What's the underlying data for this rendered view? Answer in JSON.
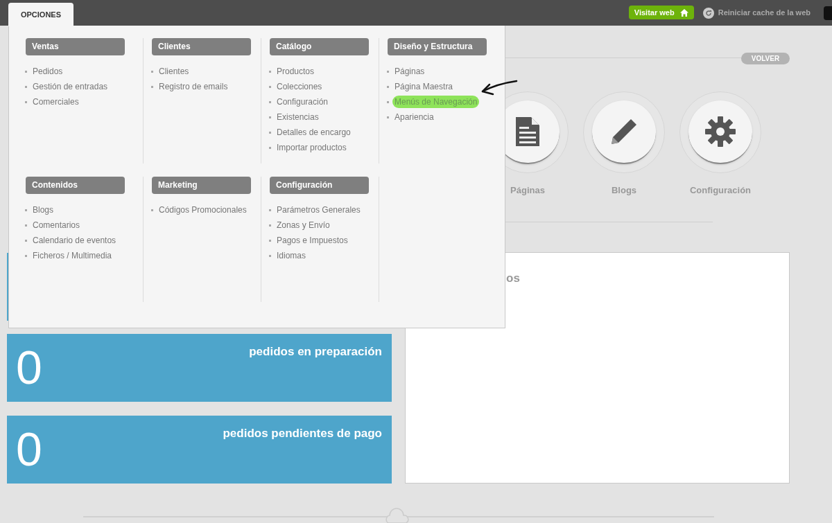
{
  "top_bar": {
    "menu_tab": {
      "label": "OPCIONES",
      "selected": true
    },
    "visit_button": "Visitar web",
    "cache_link": "Reiniciar cache de la web"
  },
  "options_menu": {
    "rows": [
      [
        {
          "title": "Ventas",
          "items": [
            {
              "label": "Pedidos",
              "highlighted": false
            },
            {
              "label": "Gestión de entradas",
              "highlighted": false
            },
            {
              "label": "Comerciales",
              "highlighted": false
            }
          ]
        },
        {
          "title": "Clientes",
          "items": [
            {
              "label": "Clientes",
              "highlighted": false
            },
            {
              "label": "Registro de emails",
              "highlighted": false
            }
          ]
        },
        {
          "title": "Catálogo",
          "items": [
            {
              "label": "Productos",
              "highlighted": false
            },
            {
              "label": "Colecciones",
              "highlighted": false
            },
            {
              "label": "Configuración",
              "highlighted": false
            },
            {
              "label": "Existencias",
              "highlighted": false
            },
            {
              "label": "Detalles de encargo",
              "highlighted": false
            },
            {
              "label": "Importar productos",
              "highlighted": false
            }
          ]
        },
        {
          "title": "Diseño y Estructura",
          "items": [
            {
              "label": "Páginas",
              "highlighted": false
            },
            {
              "label": "Página Maestra",
              "highlighted": false
            },
            {
              "label": "Menús de Navegación",
              "highlighted": true
            },
            {
              "label": "Apariencia",
              "highlighted": false
            }
          ]
        }
      ],
      [
        {
          "title": "Contenidos",
          "items": [
            {
              "label": "Blogs",
              "highlighted": false
            },
            {
              "label": "Comentarios",
              "highlighted": false
            },
            {
              "label": "Calendario de eventos",
              "highlighted": false
            },
            {
              "label": "Ficheros / Multimedia",
              "highlighted": false
            }
          ]
        },
        {
          "title": "Marketing",
          "items": [
            {
              "label": "Códigos Promocionales",
              "highlighted": false
            }
          ]
        },
        {
          "title": "Configuración",
          "items": [
            {
              "label": "Parámetros Generales",
              "highlighted": false
            },
            {
              "label": "Zonas y Envío",
              "highlighted": false
            },
            {
              "label": "Pagos e Impuestos",
              "highlighted": false
            },
            {
              "label": "Idiomas",
              "highlighted": false
            }
          ]
        }
      ]
    ]
  },
  "back_button": "VOLVER",
  "shortcuts": [
    {
      "kind": "document",
      "label": "Páginas"
    },
    {
      "kind": "pencil",
      "label": "Blogs"
    },
    {
      "kind": "gear",
      "label": "Configuración"
    }
  ],
  "stat_cards": [
    {
      "count": "0",
      "label": "pedidos en preparación"
    },
    {
      "count": "0",
      "label": "pedidos pendientes de pago"
    }
  ],
  "panel": {
    "title": "os"
  }
}
